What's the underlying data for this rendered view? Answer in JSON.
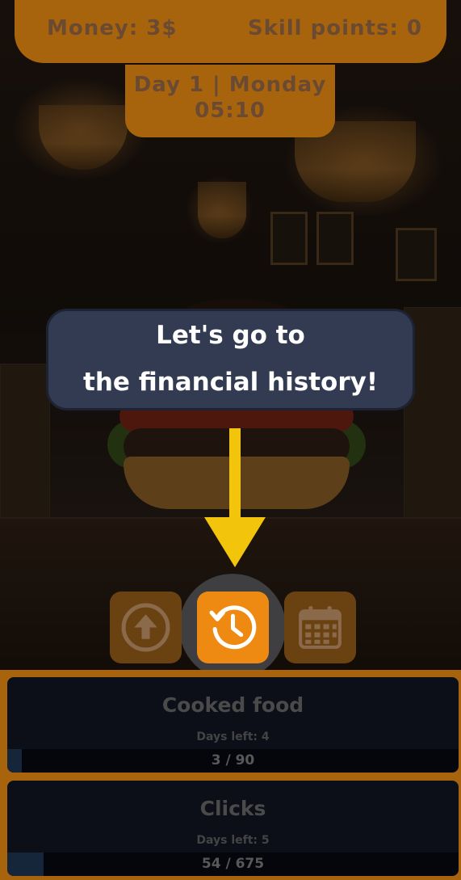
{
  "hud": {
    "money": "Money: 3$",
    "skill_points": "Skill points: 0",
    "day": "Day 1 | Monday",
    "time": "05:10"
  },
  "tutorial": {
    "line1": "Let's go to",
    "line2": "the financial history!"
  },
  "actions": [
    {
      "icon": "upgrade-arrow-icon",
      "active": false
    },
    {
      "icon": "history-clock-icon",
      "active": true
    },
    {
      "icon": "calendar-icon",
      "active": false
    }
  ],
  "goals": [
    {
      "title": "Cooked food",
      "days_left": "Days left: 4",
      "progress": "3 / 90",
      "fraction": 0.033
    },
    {
      "title": "Clicks",
      "days_left": "Days left: 5",
      "progress": "54 / 675",
      "fraction": 0.08
    }
  ],
  "colors": {
    "hud_orange": "#a8640c",
    "button_active": "#ee8a11",
    "arrow_yellow": "#f2c40b",
    "bubble": "#323b52"
  }
}
